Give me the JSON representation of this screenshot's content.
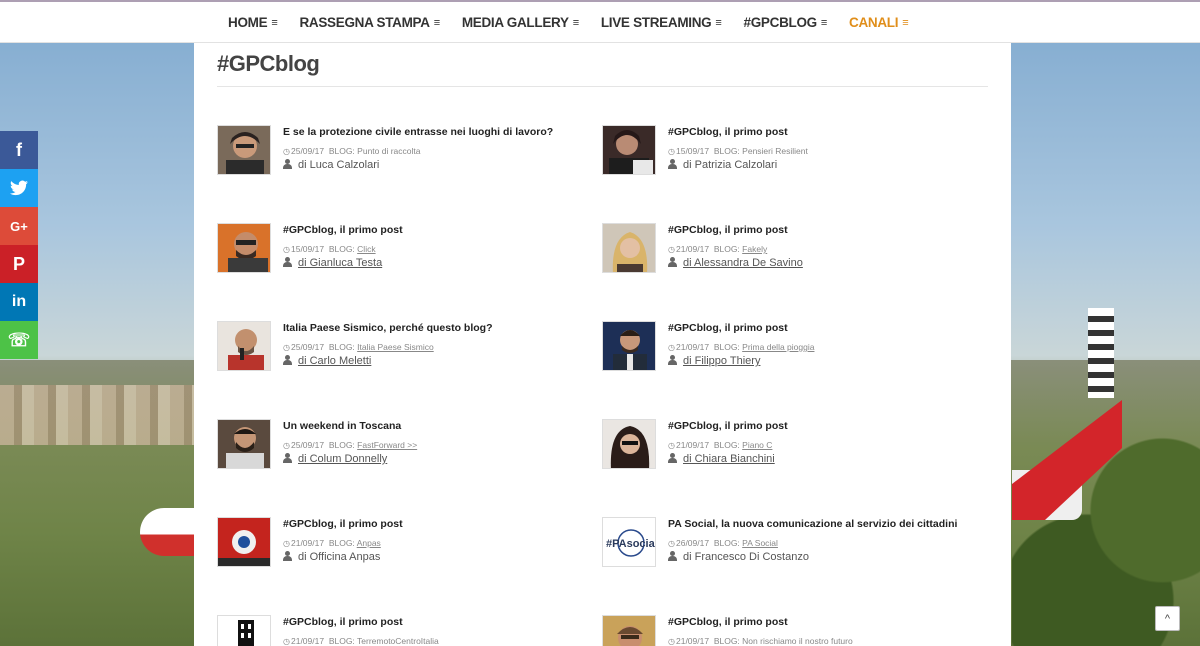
{
  "nav": {
    "items": [
      {
        "label": "HOME"
      },
      {
        "label": "RASSEGNA STAMPA"
      },
      {
        "label": "MEDIA GALLERY"
      },
      {
        "label": "LIVE STREAMING"
      },
      {
        "label": "#GPCBLOG"
      },
      {
        "label": "CANALI",
        "active": true
      }
    ],
    "caret": "≡",
    "accent": "#e08e1a"
  },
  "page": {
    "title": "#GPCblog"
  },
  "posts": [
    {
      "title": "E se la protezione civile entrasse nei luoghi di lavoro?",
      "date": "25/09/17",
      "blog_prefix": "BLOG:",
      "blog": "Punto di raccolta",
      "author": "di Luca Calzolari"
    },
    {
      "title": "#GPCblog, il primo post",
      "date": "15/09/17",
      "blog_prefix": "BLOG:",
      "blog": "Pensieri Resilient",
      "author": "di Patrizia Calzolari"
    },
    {
      "title": "#GPCblog, il primo post",
      "date": "15/09/17",
      "blog_prefix": "BLOG:",
      "blog": "Click",
      "author": "di Gianluca Testa"
    },
    {
      "title": "#GPCblog, il primo post",
      "date": "21/09/17",
      "blog_prefix": "BLOG:",
      "blog": "Fakely",
      "author": "di Alessandra De Savino"
    },
    {
      "title": "Italia Paese Sismico, perché questo blog?",
      "date": "25/09/17",
      "blog_prefix": "BLOG:",
      "blog": "Italia Paese Sismico",
      "author": "di Carlo Meletti"
    },
    {
      "title": "#GPCblog, il primo post",
      "date": "21/09/17",
      "blog_prefix": "BLOG:",
      "blog": "Prima della pioggia",
      "author": "di Filippo Thiery"
    },
    {
      "title": "Un weekend in Toscana",
      "date": "25/09/17",
      "blog_prefix": "BLOG:",
      "blog": "FastForward >>",
      "author": "di Colum Donnelly"
    },
    {
      "title": "#GPCblog, il primo post",
      "date": "21/09/17",
      "blog_prefix": "BLOG:",
      "blog": "Piano C",
      "author": "di Chiara Bianchini"
    },
    {
      "title": "#GPCblog, il primo post",
      "date": "21/09/17",
      "blog_prefix": "BLOG:",
      "blog": "Anpas",
      "author": "di Officina Anpas"
    },
    {
      "title": "PA Social, la nuova comunicazione al servizio dei cittadini",
      "date": "26/09/17",
      "blog_prefix": "BLOG:",
      "blog": "PA Social",
      "author": "di Francesco Di Costanzo"
    },
    {
      "title": "#GPCblog, il primo post",
      "date": "21/09/17",
      "blog_prefix": "BLOG:",
      "blog": "TerremotoCentroItalia",
      "author": ""
    },
    {
      "title": "#GPCblog, il primo post",
      "date": "21/09/17",
      "blog_prefix": "BLOG:",
      "blog": "Non rischiamo il nostro futuro",
      "author": ""
    }
  ],
  "thumb_logo_text": "#PAsocial",
  "share": {
    "facebook": "f",
    "twitter": "t",
    "googleplus": "G+",
    "pinterest": "P",
    "linkedin": "in",
    "whatsapp": "☏"
  },
  "scroll_top": "^"
}
